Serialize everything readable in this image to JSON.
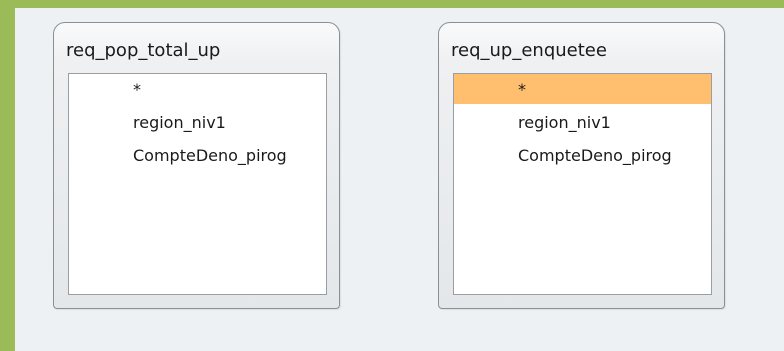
{
  "tables": [
    {
      "title": "req_pop_total_up",
      "fields": [
        "*",
        "region_niv1",
        "CompteDeno_pirog"
      ],
      "selected_index": null
    },
    {
      "title": "req_up_enquetee",
      "fields": [
        "*",
        "region_niv1",
        "CompteDeno_pirog"
      ],
      "selected_index": 0
    }
  ],
  "colors": {
    "frame_border": "#9bbb59",
    "canvas_background": "#eef1f3",
    "selection_highlight": "#ffbf6e"
  }
}
